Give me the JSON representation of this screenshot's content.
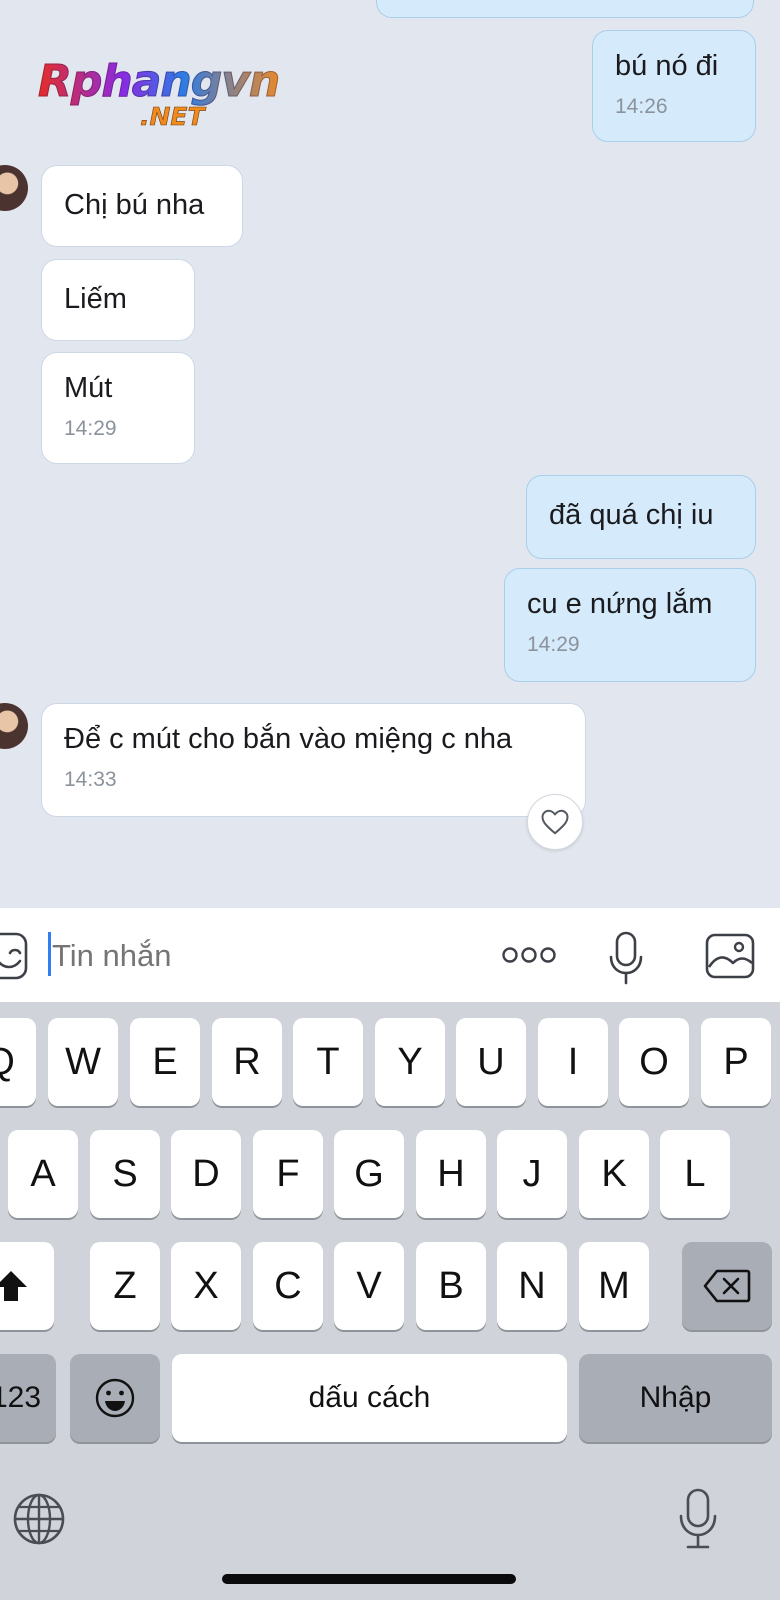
{
  "watermark": {
    "main": "Rphangvn",
    "sub": ".NET"
  },
  "messages": [
    {
      "side": "out",
      "text": "bú nó đi",
      "time": "14:26"
    },
    {
      "side": "in",
      "text": "Chị bú nha",
      "time": ""
    },
    {
      "side": "in",
      "text": "Liếm",
      "time": ""
    },
    {
      "side": "in",
      "text": "Mút",
      "time": "14:29"
    },
    {
      "side": "out",
      "text": "đã quá chị iu",
      "time": ""
    },
    {
      "side": "out",
      "text": "cu e nứng lắm",
      "time": "14:29"
    },
    {
      "side": "in",
      "text": "Để c mút cho bắn vào miệng c nha",
      "time": "14:33"
    }
  ],
  "input": {
    "placeholder": "Tin nhắn"
  },
  "icons": {
    "sticker": "sticker-icon",
    "more": "more-dots-icon",
    "mic": "microphone-icon",
    "image": "image-icon",
    "heart": "heart-icon",
    "shift": "shift-icon",
    "backspace": "backspace-icon",
    "emoji": "emoji-icon",
    "globe": "globe-icon",
    "dictation": "dictation-mic-icon"
  },
  "keyboard": {
    "row1": [
      "Q",
      "W",
      "E",
      "R",
      "T",
      "Y",
      "U",
      "I",
      "O",
      "P"
    ],
    "row2": [
      "A",
      "S",
      "D",
      "F",
      "G",
      "H",
      "J",
      "K",
      "L"
    ],
    "row3": [
      "Z",
      "X",
      "C",
      "V",
      "B",
      "N",
      "M"
    ],
    "numbers_label": "123",
    "space_label": "dấu cách",
    "return_label": "Nhập"
  },
  "colors": {
    "chat_background": "#e2e6ee",
    "incoming_bubble": "#ffffff",
    "outgoing_bubble": "#d5ebfb",
    "caret": "#2f7ff2",
    "keyboard_background": "#d0d3d9"
  }
}
